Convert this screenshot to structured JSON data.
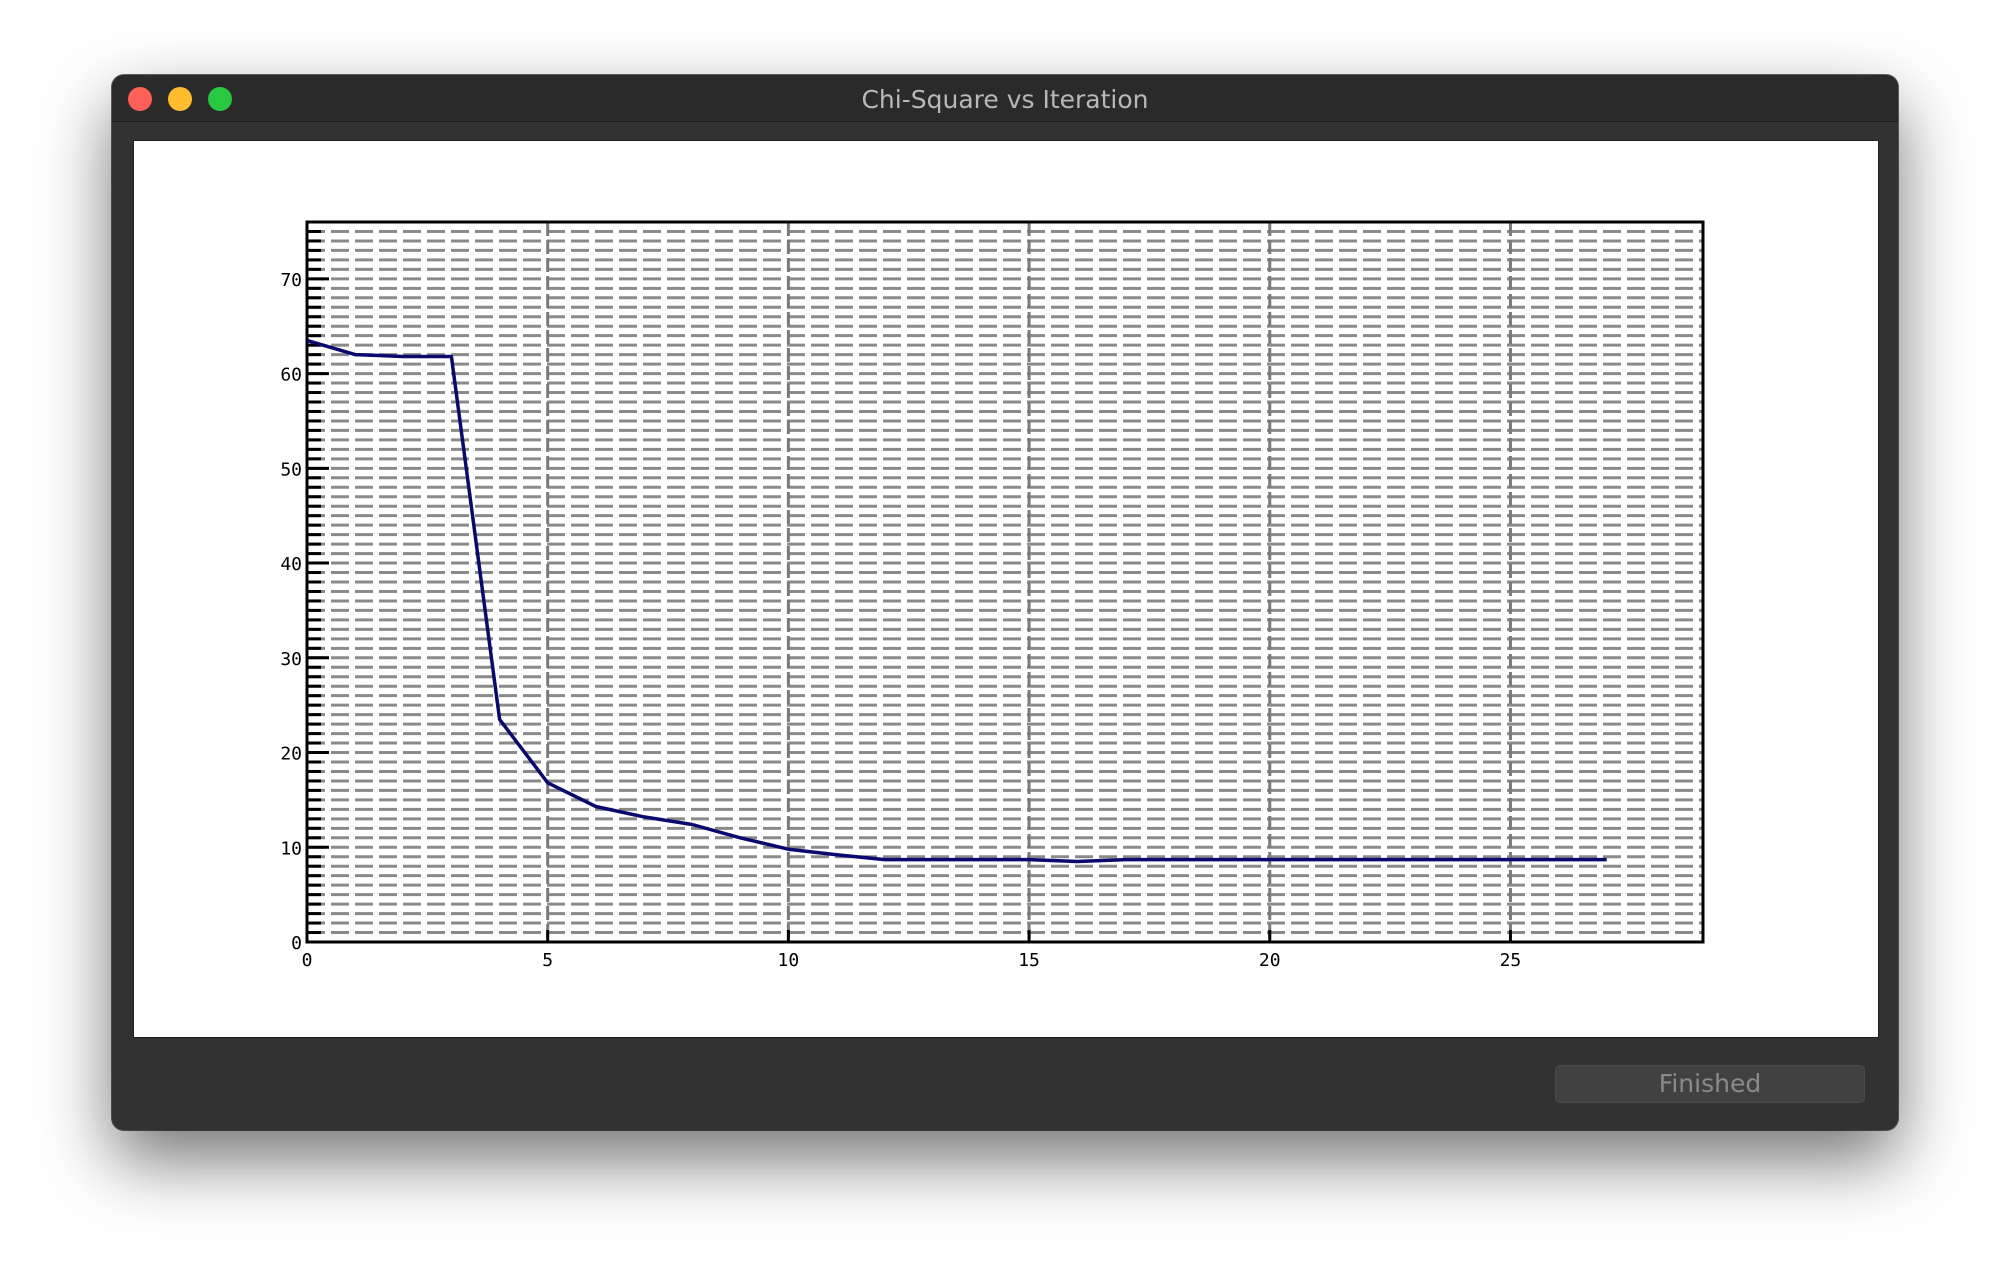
{
  "window": {
    "title": "Chi-Square vs Iteration"
  },
  "status": {
    "label": "Finished"
  },
  "chart_data": {
    "type": "line",
    "title": "",
    "xlabel": "",
    "ylabel": "",
    "xlim": [
      0,
      29
    ],
    "ylim": [
      0,
      76
    ],
    "x_ticks": [
      0,
      5,
      10,
      15,
      20,
      25
    ],
    "y_ticks": [
      0,
      10,
      20,
      30,
      40,
      50,
      60,
      70
    ],
    "grid": true,
    "line_color": "#0a0a6e",
    "series": [
      {
        "x": [
          0,
          1,
          2,
          3,
          4,
          5,
          6,
          7,
          8,
          9,
          10,
          11,
          12,
          13,
          14,
          15,
          16,
          17,
          18,
          19,
          20,
          21,
          22,
          23,
          24,
          25,
          26,
          27
        ],
        "y": [
          63.5,
          62.0,
          61.8,
          61.8,
          23.5,
          16.8,
          14.3,
          13.2,
          12.4,
          11.0,
          9.8,
          9.2,
          8.7,
          8.7,
          8.7,
          8.7,
          8.5,
          8.7,
          8.7,
          8.7,
          8.7,
          8.7,
          8.7,
          8.7,
          8.7,
          8.7,
          8.7,
          8.7
        ]
      }
    ]
  }
}
